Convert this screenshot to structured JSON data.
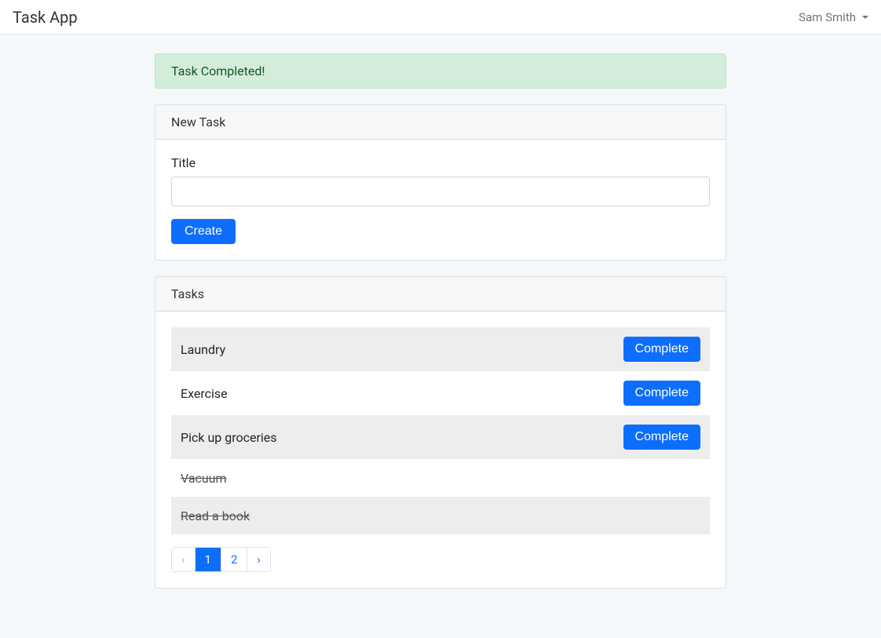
{
  "navbar": {
    "brand": "Task App",
    "user": "Sam Smith"
  },
  "alert": {
    "message": "Task Completed!"
  },
  "new_task": {
    "header": "New Task",
    "title_label": "Title",
    "title_value": "",
    "create_label": "Create"
  },
  "tasks_card": {
    "header": "Tasks",
    "complete_label": "Complete",
    "items": [
      {
        "title": "Laundry",
        "completed": false
      },
      {
        "title": "Exercise",
        "completed": false
      },
      {
        "title": "Pick up groceries",
        "completed": false
      },
      {
        "title": "Vacuum",
        "completed": true
      },
      {
        "title": "Read a book",
        "completed": true
      }
    ]
  },
  "pagination": {
    "prev": "‹",
    "next": "›",
    "pages": [
      "1",
      "2"
    ],
    "active": "1"
  }
}
